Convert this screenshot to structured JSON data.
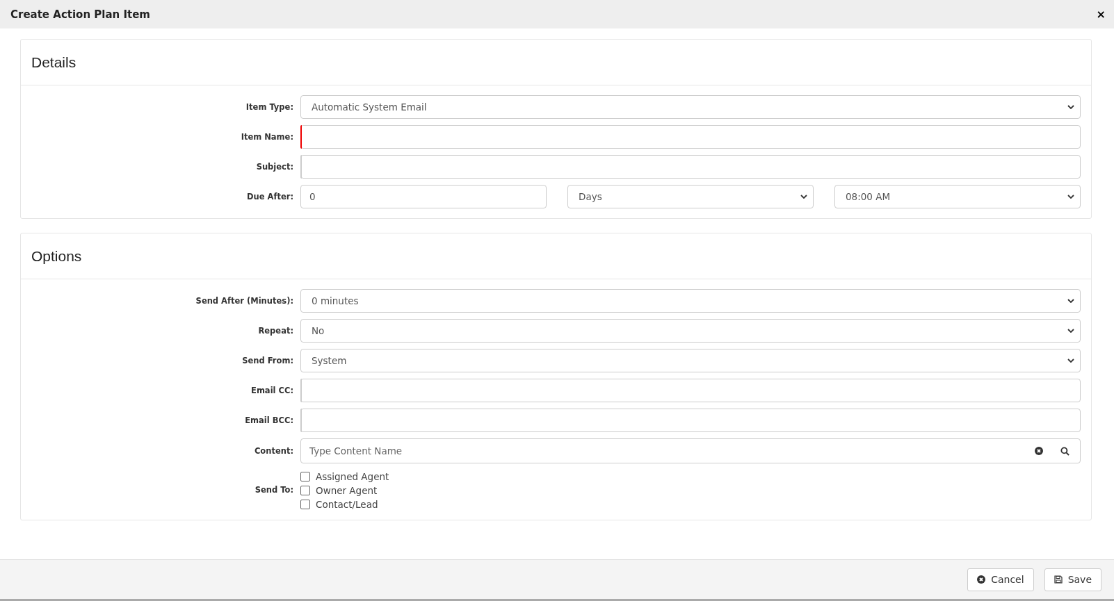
{
  "dialog": {
    "title": "Create Action Plan Item",
    "close": "×"
  },
  "sections": [
    {
      "title": "Details",
      "fields": [
        {
          "label": "Item Type:",
          "kind": "select",
          "value": "Automatic System Email"
        },
        {
          "label": "Item Name:",
          "kind": "text",
          "invalid": true
        },
        {
          "label": "Subject:",
          "kind": "text",
          "invalid": false
        },
        {
          "label": "Due After:",
          "kind": "due",
          "value": "0",
          "unit": "Days",
          "time": "08:00 AM"
        }
      ]
    },
    {
      "title": "Options",
      "fields": [
        {
          "label": "Send After (Minutes):",
          "kind": "select",
          "value": "0 minutes"
        },
        {
          "label": "Repeat:",
          "kind": "select",
          "value": "No"
        },
        {
          "label": "Send From:",
          "kind": "select",
          "value": "System"
        },
        {
          "label": "Email CC:",
          "kind": "text",
          "invalid": false
        },
        {
          "label": "Email BCC:",
          "kind": "text",
          "invalid": false
        },
        {
          "label": "Content:",
          "kind": "search",
          "placeholder": "Type Content Name"
        },
        {
          "label": "Send To:",
          "kind": "checks",
          "options": [
            {
              "label": "Assigned Agent",
              "checked": false
            },
            {
              "label": "Owner Agent",
              "checked": false
            },
            {
              "label": "Contact/Lead",
              "checked": false
            }
          ]
        }
      ]
    }
  ],
  "buttons": [
    {
      "label": "Cancel",
      "kind": "cancel"
    },
    {
      "label": "Save",
      "kind": "save"
    }
  ]
}
